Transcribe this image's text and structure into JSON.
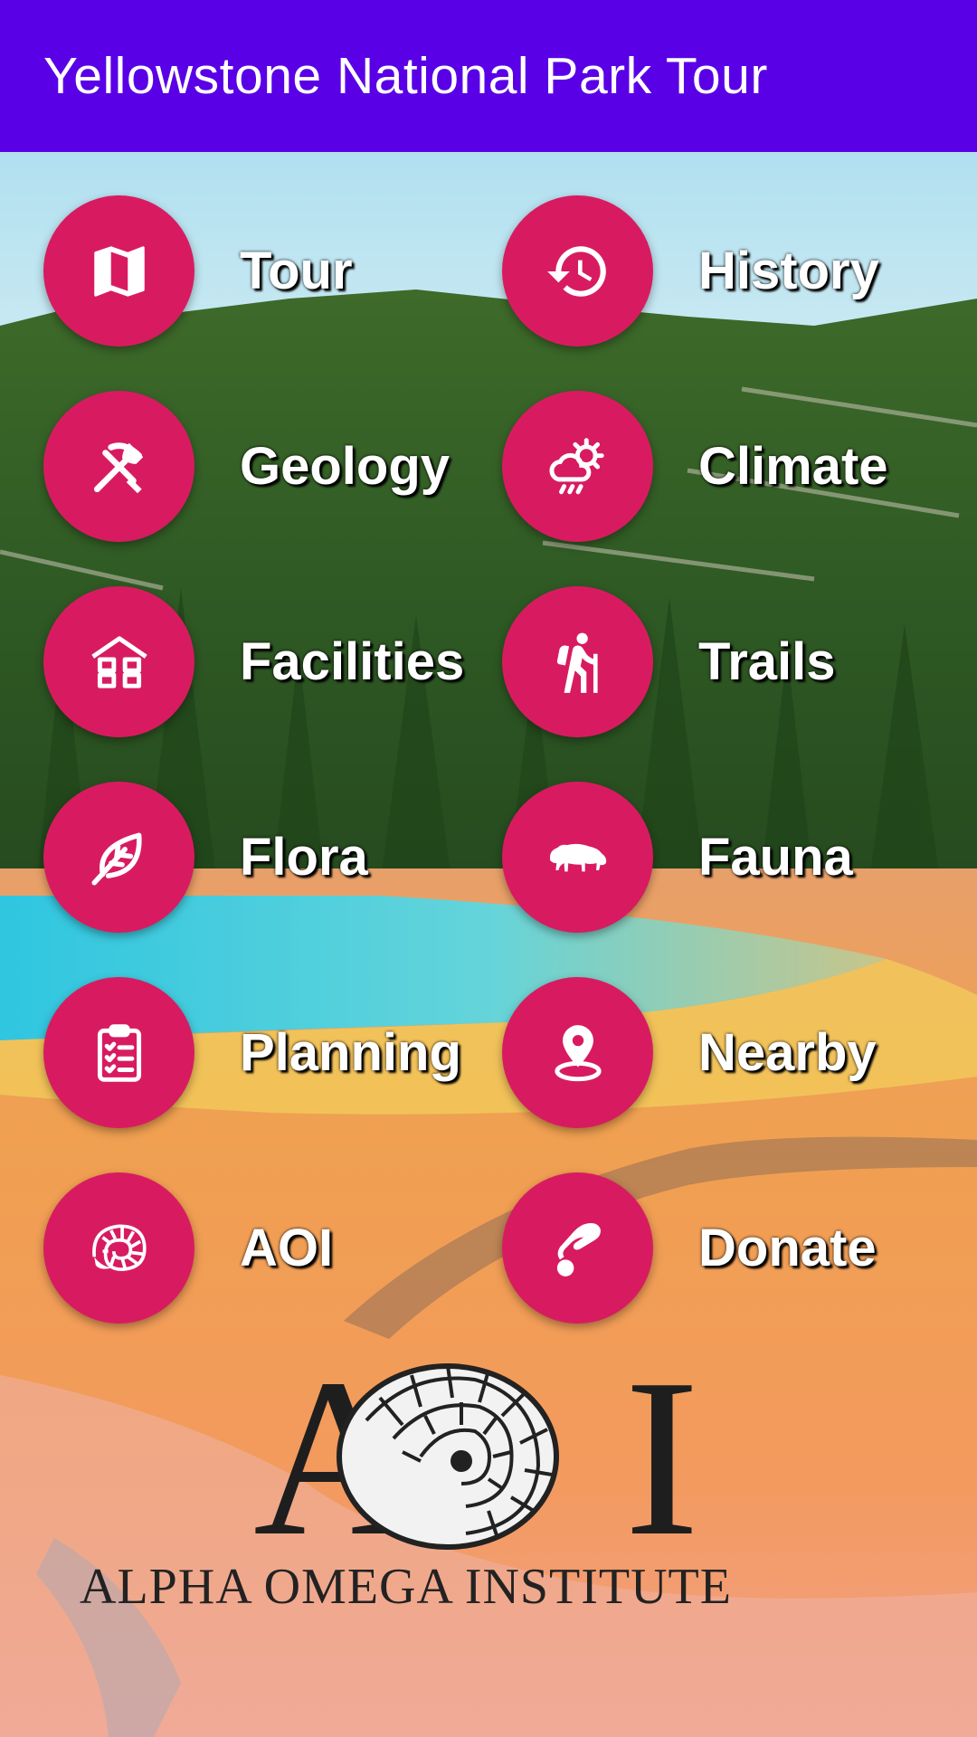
{
  "colors": {
    "appbar": "#5a00e6",
    "button": "#d81b60",
    "label": "#ffffff"
  },
  "appbar": {
    "title": "Yellowstone National Park Tour"
  },
  "menu": [
    {
      "label": "Tour",
      "icon": "map-icon"
    },
    {
      "label": "History",
      "icon": "history-icon"
    },
    {
      "label": "Geology",
      "icon": "pick-shovel-icon"
    },
    {
      "label": "Climate",
      "icon": "weather-icon"
    },
    {
      "label": "Facilities",
      "icon": "building-icon"
    },
    {
      "label": "Trails",
      "icon": "hiker-icon"
    },
    {
      "label": "Flora",
      "icon": "leaf-icon"
    },
    {
      "label": "Fauna",
      "icon": "bison-icon"
    },
    {
      "label": "Planning",
      "icon": "clipboard-icon"
    },
    {
      "label": "Nearby",
      "icon": "location-pin-icon"
    },
    {
      "label": "AOI",
      "icon": "ammonite-icon"
    },
    {
      "label": "Donate",
      "icon": "donate-hand-icon"
    }
  ],
  "logo": {
    "letters": "AOI",
    "name": "ALPHA OMEGA INSTITUTE"
  }
}
